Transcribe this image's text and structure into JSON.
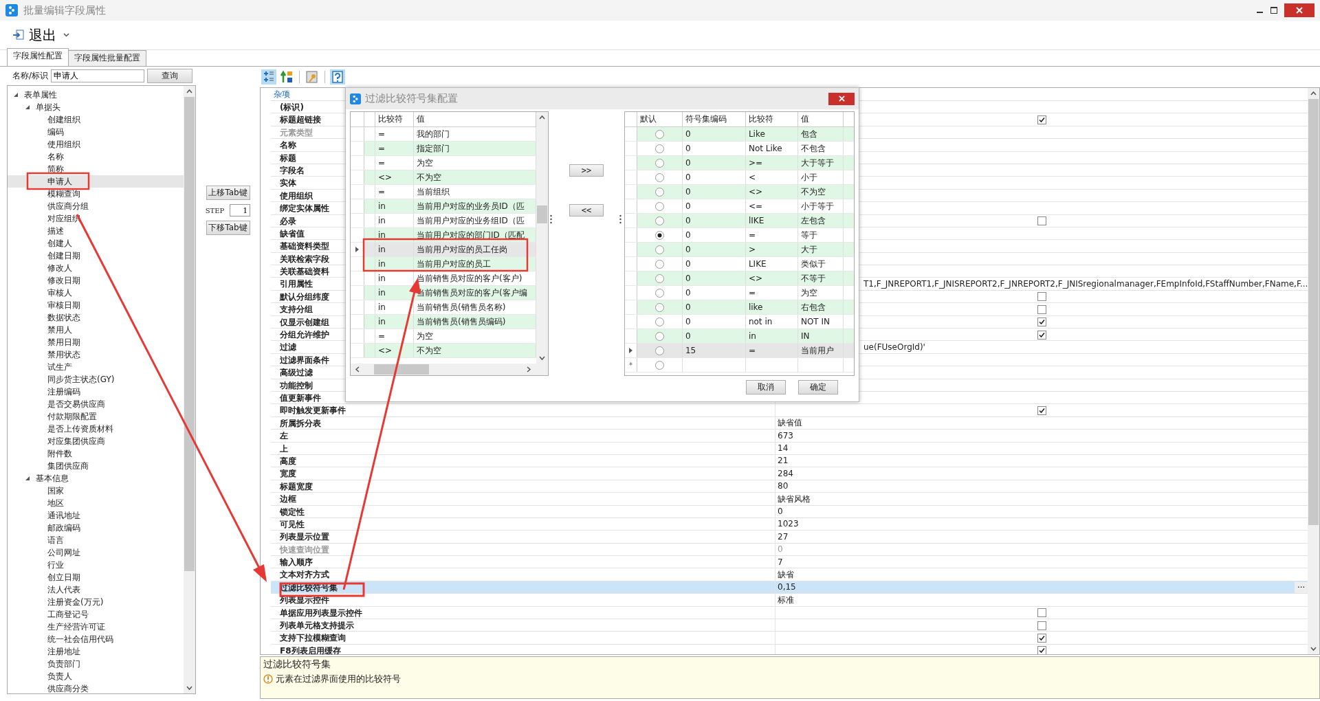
{
  "window": {
    "title": "批量编辑字段属性"
  },
  "toolbar": {
    "exit_label": "退出"
  },
  "tabs": [
    {
      "label": "字段属性配置",
      "selected": true
    },
    {
      "label": "字段属性批量配置",
      "selected": false
    }
  ],
  "search": {
    "label": "名称/标识",
    "value": "申请人",
    "button": "查询"
  },
  "tree": [
    {
      "label": "表单属性",
      "expanded": true,
      "children": [
        {
          "label": "单据头",
          "expanded": true,
          "children": [
            {
              "label": "创建组织",
              "selected": false
            },
            {
              "label": "编码",
              "selected": false
            },
            {
              "label": "使用组织",
              "selected": false
            },
            {
              "label": "名称",
              "selected": false
            },
            {
              "label": "简称",
              "selected": false
            },
            {
              "label": "申请人",
              "selected": true
            },
            {
              "label": "模糊查询",
              "selected": false
            },
            {
              "label": "供应商分组",
              "selected": false
            },
            {
              "label": "对应组织",
              "selected": false
            },
            {
              "label": "描述",
              "selected": false
            },
            {
              "label": "创建人",
              "selected": false
            },
            {
              "label": "创建日期",
              "selected": false
            },
            {
              "label": "修改人",
              "selected": false
            },
            {
              "label": "修改日期",
              "selected": false
            },
            {
              "label": "审核人",
              "selected": false
            },
            {
              "label": "审核日期",
              "selected": false
            },
            {
              "label": "数据状态",
              "selected": false
            },
            {
              "label": "禁用人",
              "selected": false
            },
            {
              "label": "禁用日期",
              "selected": false
            },
            {
              "label": "禁用状态",
              "selected": false
            },
            {
              "label": "试生产",
              "selected": false
            },
            {
              "label": "同步货主状态(GY)",
              "selected": false
            },
            {
              "label": "注册编码",
              "selected": false
            },
            {
              "label": "是否交易供应商",
              "selected": false
            },
            {
              "label": "付款期限配置",
              "selected": false
            },
            {
              "label": "是否上传资质材料",
              "selected": false
            },
            {
              "label": "对应集团供应商",
              "selected": false
            },
            {
              "label": "附件数",
              "selected": false
            },
            {
              "label": "集团供应商",
              "selected": false
            }
          ]
        },
        {
          "label": "基本信息",
          "expanded": true,
          "children": [
            {
              "label": "国家",
              "selected": false
            },
            {
              "label": "地区",
              "selected": false
            },
            {
              "label": "通讯地址",
              "selected": false
            },
            {
              "label": "邮政编码",
              "selected": false
            },
            {
              "label": "语言",
              "selected": false
            },
            {
              "label": "公司网址",
              "selected": false
            },
            {
              "label": "行业",
              "selected": false
            },
            {
              "label": "创立日期",
              "selected": false
            },
            {
              "label": "法人代表",
              "selected": false
            },
            {
              "label": "注册资金(万元)",
              "selected": false
            },
            {
              "label": "工商登记号",
              "selected": false
            },
            {
              "label": "生产经营许可证",
              "selected": false
            },
            {
              "label": "统一社会信用代码",
              "selected": false
            },
            {
              "label": "注册地址",
              "selected": false
            },
            {
              "label": "负责部门",
              "selected": false
            },
            {
              "label": "负责人",
              "selected": false
            },
            {
              "label": "供应商分类",
              "selected": false
            }
          ]
        }
      ]
    }
  ],
  "move_panel": {
    "up_button": "上移Tab键",
    "step_label": "STEP",
    "step_value": "1",
    "down_button": "下移Tab键"
  },
  "property_toolbar": [
    {
      "kind": "categorized",
      "selected": true
    },
    {
      "kind": "alphabetical",
      "selected": false
    },
    {
      "kind": "property-pages",
      "selected": false
    },
    {
      "kind": "help",
      "selected": true
    }
  ],
  "property_grid": {
    "category": "杂项",
    "rows": [
      {
        "name": "(标识)",
        "kind": "text",
        "selected": false
      },
      {
        "name": "标题超链接",
        "kind": "check",
        "checked": true,
        "selected": false
      },
      {
        "name": "元素类型",
        "kind": "text",
        "disabled": true,
        "selected": false
      },
      {
        "name": "名称",
        "kind": "text",
        "selected": false
      },
      {
        "name": "标题",
        "kind": "text",
        "selected": false
      },
      {
        "name": "字段名",
        "kind": "text",
        "selected": false
      },
      {
        "name": "实体",
        "kind": "text",
        "selected": false
      },
      {
        "name": "使用组织",
        "kind": "text",
        "selected": false
      },
      {
        "name": "绑定实体属性",
        "kind": "text",
        "selected": false
      },
      {
        "name": "必录",
        "kind": "check",
        "checked": false,
        "selected": false
      },
      {
        "name": "缺省值",
        "kind": "text",
        "selected": false
      },
      {
        "name": "基础资料类型",
        "kind": "text",
        "selected": false
      },
      {
        "name": "关联检索字段",
        "kind": "text",
        "selected": false
      },
      {
        "name": "关联基础资料",
        "kind": "text",
        "selected": false
      },
      {
        "name": "引用属性",
        "kind": "text",
        "value": "T1,F_JNREPORT1,F_JNISREPORT2,F_JNREPORT2,F_JNISregionalmanager,FEmpInfoId,FStaffNumber,FName,F...",
        "selected": false
      },
      {
        "name": "默认分组纬度",
        "kind": "check",
        "checked": false,
        "selected": false
      },
      {
        "name": "支持分组",
        "kind": "check",
        "checked": false,
        "selected": false
      },
      {
        "name": "仅显示创建组",
        "kind": "check",
        "checked": true,
        "selected": false
      },
      {
        "name": "分组允许维护",
        "kind": "check",
        "checked": true,
        "selected": false
      },
      {
        "name": "过滤",
        "kind": "text",
        "value": "ue(FUseOrgId)'",
        "selected": false
      },
      {
        "name": "过滤界面条件",
        "kind": "text",
        "selected": false
      },
      {
        "name": "高级过滤",
        "kind": "text",
        "selected": false
      },
      {
        "name": "功能控制",
        "kind": "text",
        "selected": false
      },
      {
        "name": "值更新事件",
        "kind": "text",
        "selected": false
      },
      {
        "name": "即时触发更新事件",
        "kind": "check",
        "checked": true,
        "selected": false
      },
      {
        "name": "所属拆分表",
        "kind": "text",
        "value": "缺省值",
        "selected": false
      },
      {
        "name": "左",
        "kind": "text",
        "value": "673",
        "selected": false
      },
      {
        "name": "上",
        "kind": "text",
        "value": "14",
        "selected": false
      },
      {
        "name": "高度",
        "kind": "text",
        "value": "21",
        "selected": false
      },
      {
        "name": "宽度",
        "kind": "text",
        "value": "284",
        "selected": false
      },
      {
        "name": "标题宽度",
        "kind": "text",
        "value": "80",
        "selected": false
      },
      {
        "name": "边框",
        "kind": "text",
        "value": "缺省风格",
        "selected": false
      },
      {
        "name": "锁定性",
        "kind": "text",
        "value": "0",
        "selected": false
      },
      {
        "name": "可见性",
        "kind": "text",
        "value": "1023",
        "selected": false
      },
      {
        "name": "列表显示位置",
        "kind": "text",
        "value": "27",
        "selected": false
      },
      {
        "name": "快速查询位置",
        "kind": "text",
        "value": "0",
        "disabled": true,
        "selected": false
      },
      {
        "name": "输入顺序",
        "kind": "text",
        "value": "7",
        "selected": false
      },
      {
        "name": "文本对齐方式",
        "kind": "text",
        "value": "缺省",
        "selected": false
      },
      {
        "name": "过滤比较符号集",
        "kind": "text",
        "value": "0,15",
        "button": "···",
        "selected": true
      },
      {
        "name": "列表显示控件",
        "kind": "text",
        "value": "标准",
        "selected": false
      },
      {
        "name": "单据应用列表显示控件",
        "kind": "check",
        "checked": false,
        "selected": false
      },
      {
        "name": "列表单元格支持提示",
        "kind": "check",
        "checked": false,
        "selected": false
      },
      {
        "name": "支持下拉模糊查询",
        "kind": "check",
        "checked": true,
        "selected": false
      },
      {
        "name": "F8列表启用缓存",
        "kind": "check",
        "checked": true,
        "selected": false
      }
    ]
  },
  "description": {
    "title": "过滤比较符号集",
    "text": "元素在过滤界面使用的比较符号"
  },
  "dialog": {
    "title": "过滤比较符号集配置",
    "left": {
      "columns": [
        "比较符",
        "值"
      ],
      "rows": [
        {
          "op": "=",
          "value": "我的部门",
          "current": false
        },
        {
          "op": "=",
          "value": "指定部门",
          "current": false
        },
        {
          "op": "=",
          "value": "为空",
          "current": false
        },
        {
          "op": "<>",
          "value": "不为空",
          "current": false
        },
        {
          "op": "=",
          "value": "当前组织",
          "current": false
        },
        {
          "op": "in",
          "value": "当前用户对应的业务员ID（匹",
          "current": false
        },
        {
          "op": "in",
          "value": "当前用户对应的业务组ID（匹",
          "current": false
        },
        {
          "op": "in",
          "value": "当前用户对应的部门ID（匹配",
          "current": false
        },
        {
          "op": "in",
          "value": "当前用户对应的员工任岗",
          "current": true
        },
        {
          "op": "in",
          "value": "当前用户对应的员工",
          "current": false
        },
        {
          "op": "in",
          "value": "当前销售员对应的客户(客户)",
          "current": false
        },
        {
          "op": "in",
          "value": "当前销售员对应的客户(客户编",
          "current": false
        },
        {
          "op": "in",
          "value": "当前销售员(销售员名称)",
          "current": false
        },
        {
          "op": "in",
          "value": "当前销售员(销售员编码)",
          "current": false
        },
        {
          "op": "=",
          "value": "为空",
          "current": false
        },
        {
          "op": "<>",
          "value": "不为空",
          "current": false
        }
      ]
    },
    "add_button": ">>",
    "remove_button": "<<",
    "right": {
      "columns": [
        "默认",
        "符号集编码",
        "比较符",
        "值"
      ],
      "rows": [
        {
          "default": false,
          "code": "0",
          "op": "Like",
          "value": "包含",
          "current": false
        },
        {
          "default": false,
          "code": "0",
          "op": "Not Like",
          "value": "不包含",
          "current": false
        },
        {
          "default": false,
          "code": "0",
          "op": ">=",
          "value": "大于等于",
          "current": false
        },
        {
          "default": false,
          "code": "0",
          "op": "<",
          "value": "小于",
          "current": false
        },
        {
          "default": false,
          "code": "0",
          "op": "<>",
          "value": "不为空",
          "current": false
        },
        {
          "default": false,
          "code": "0",
          "op": "<=",
          "value": "小于等于",
          "current": false
        },
        {
          "default": false,
          "code": "0",
          "op": "lIKE",
          "value": "左包含",
          "current": false
        },
        {
          "default": true,
          "code": "0",
          "op": "=",
          "value": "等于",
          "current": false
        },
        {
          "default": false,
          "code": "0",
          "op": ">",
          "value": "大于",
          "current": false
        },
        {
          "default": false,
          "code": "0",
          "op": "LIKE",
          "value": "类似于",
          "current": false
        },
        {
          "default": false,
          "code": "0",
          "op": "<>",
          "value": "不等于",
          "current": false
        },
        {
          "default": false,
          "code": "0",
          "op": "=",
          "value": "为空",
          "current": false
        },
        {
          "default": false,
          "code": "0",
          "op": "like",
          "value": "右包含",
          "current": false
        },
        {
          "default": false,
          "code": "0",
          "op": "not in",
          "value": "NOT IN",
          "current": false
        },
        {
          "default": false,
          "code": "0",
          "op": "in",
          "value": "IN",
          "current": false
        },
        {
          "default": false,
          "code": "15",
          "op": "=",
          "value": "当前用户",
          "current": true
        }
      ],
      "new_row_marker": "*",
      "new_row_default": false
    },
    "cancel_button": "取消",
    "ok_button": "确定"
  }
}
